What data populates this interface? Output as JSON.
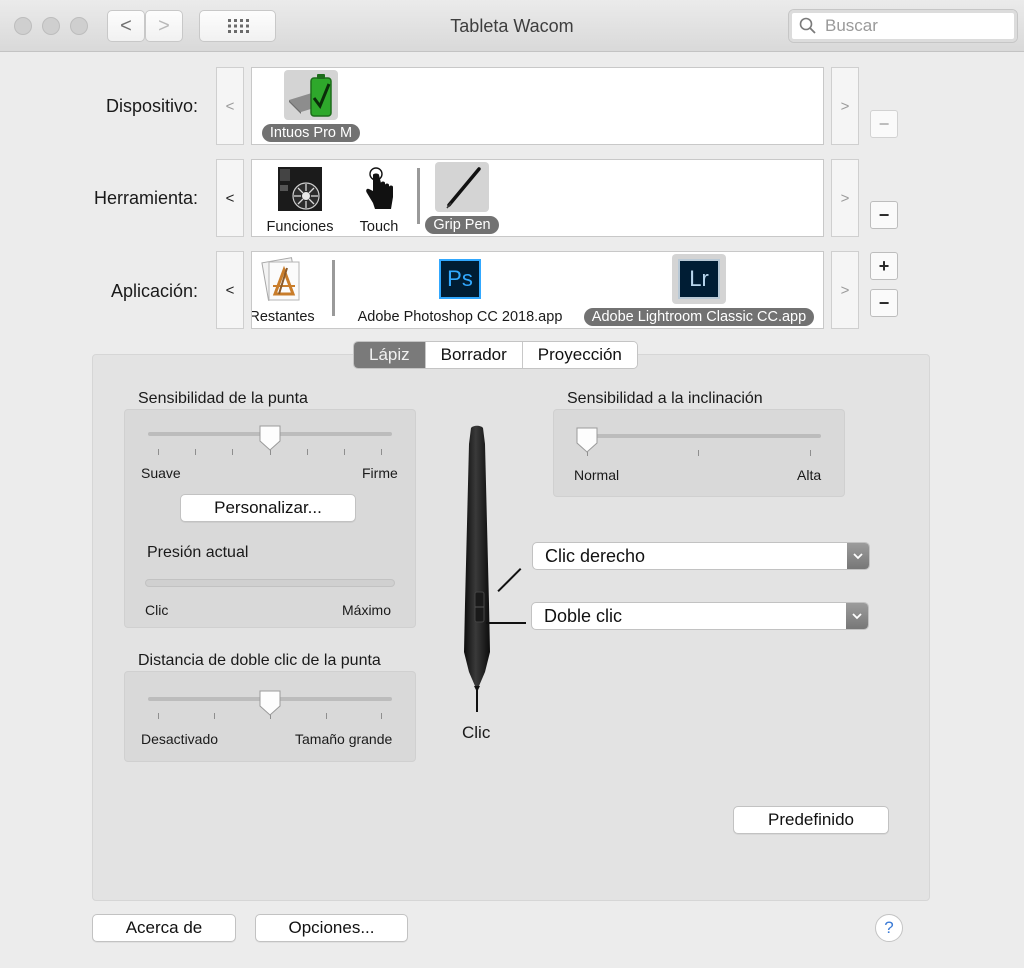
{
  "window": {
    "title": "Tableta Wacom"
  },
  "toolbar": {
    "back_glyph": "<",
    "forward_glyph": ">",
    "search_placeholder": "Buscar"
  },
  "dispositivo": {
    "label": "Dispositivo:",
    "left_arrow": "<",
    "right_arrow": ">",
    "items": [
      {
        "label": "Intuos Pro M",
        "icon": "tablet-battery-icon",
        "selected": true
      }
    ],
    "remove_button": "−"
  },
  "herramienta": {
    "label": "Herramienta:",
    "left_arrow": "<",
    "right_arrow": ">",
    "items": [
      {
        "label": "Funciones",
        "icon": "functions-icon"
      },
      {
        "label": "Touch",
        "icon": "touch-hand-icon"
      },
      {
        "label": "Grip Pen",
        "icon": "pen-icon",
        "selected": true
      }
    ],
    "remove_button": "−"
  },
  "aplicacion": {
    "label": "Aplicación:",
    "left_arrow": "<",
    "right_arrow": ">",
    "items": [
      {
        "label": "Restantes",
        "icon": "all-apps-icon"
      },
      {
        "label": "Adobe Photoshop CC 2018.app",
        "icon": "photoshop-icon",
        "icon_text": "Ps"
      },
      {
        "label": "Adobe Lightroom Classic CC.app",
        "icon": "lightroom-icon",
        "icon_text": "Lr",
        "selected": true
      }
    ],
    "add_button": "+",
    "remove_button": "−"
  },
  "tabs": [
    {
      "label": "Lápiz",
      "selected": true
    },
    {
      "label": "Borrador"
    },
    {
      "label": "Proyección"
    }
  ],
  "tip_feel": {
    "title": "Sensibilidad de la punta",
    "min_label": "Suave",
    "max_label": "Firme",
    "value_fraction": 0.5,
    "customize_button": "Personalizar...",
    "current_pressure_title": "Presión actual",
    "pressure_min": "Clic",
    "pressure_max": "Máximo",
    "pressure_value": 0
  },
  "double_click": {
    "title": "Distancia de doble clic de la punta",
    "min_label": "Desactivado",
    "max_label": "Tamaño grande",
    "value_fraction": 0.5
  },
  "tilt": {
    "title": "Sensibilidad a la inclinación",
    "min_label": "Normal",
    "max_label": "Alta",
    "value_fraction": 0
  },
  "pen_buttons": {
    "upper": "Clic derecho",
    "lower": "Doble clic",
    "tip": "Clic"
  },
  "default_button": "Predefinido",
  "footer": {
    "about_button": "Acerca de",
    "options_button": "Opciones...",
    "help_glyph": "?"
  },
  "colors": {
    "selection_gray": "#727272",
    "window_bg": "#ececec",
    "pane_bg": "#e3e3e3",
    "ps_blue": "#31a8ff",
    "lr_blue": "#31a8ff"
  }
}
